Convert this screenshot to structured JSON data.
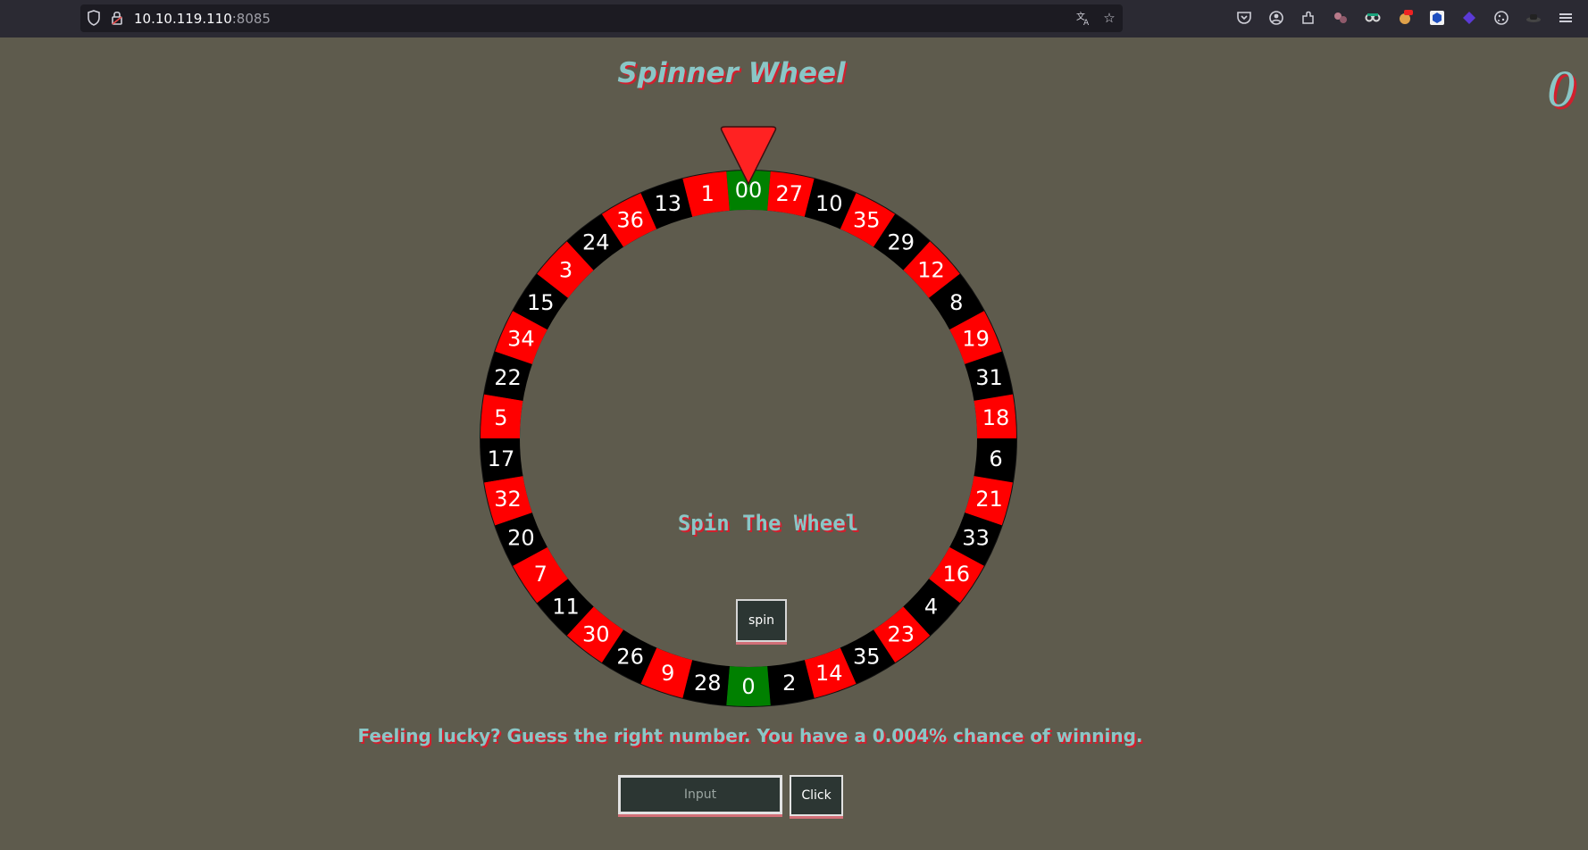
{
  "browser": {
    "url_host": "10.10.119.110",
    "url_port": ":8085",
    "icons": [
      "shield-icon",
      "lock-icon",
      "translate-icon",
      "star-icon",
      "pocket-icon",
      "account-icon",
      "extensions-icon",
      "extension-icon",
      "extension-icon",
      "extension-icon",
      "extension-icon",
      "extension-icon",
      "cookie-icon",
      "extension-icon",
      "menu-icon"
    ]
  },
  "page": {
    "title": "Spinner Wheel",
    "score": "0",
    "spin_caption": "Spin The Wheel",
    "spin_label": "spin",
    "lucky_text": "Feeling lucky? Guess the right number. You have a 0.004% chance of winning.",
    "input_placeholder": "Input",
    "click_label": "Click"
  },
  "colors": {
    "background": "#5e5b4d",
    "accent_teal": "#8ac6c6",
    "accent_red": "#d21f2d",
    "pocket_red": "#ff0000",
    "pocket_black": "#000000",
    "pocket_green": "#008000",
    "pointer": "#ff2222"
  },
  "wheel": {
    "pockets": [
      {
        "label": "00",
        "color": "green"
      },
      {
        "label": "27",
        "color": "red"
      },
      {
        "label": "10",
        "color": "black"
      },
      {
        "label": "35",
        "color": "red"
      },
      {
        "label": "29",
        "color": "black"
      },
      {
        "label": "12",
        "color": "red"
      },
      {
        "label": "8",
        "color": "black"
      },
      {
        "label": "19",
        "color": "red"
      },
      {
        "label": "31",
        "color": "black"
      },
      {
        "label": "18",
        "color": "red"
      },
      {
        "label": "6",
        "color": "black"
      },
      {
        "label": "21",
        "color": "red"
      },
      {
        "label": "33",
        "color": "black"
      },
      {
        "label": "16",
        "color": "red"
      },
      {
        "label": "4",
        "color": "black"
      },
      {
        "label": "23",
        "color": "red"
      },
      {
        "label": "35",
        "color": "black"
      },
      {
        "label": "14",
        "color": "red"
      },
      {
        "label": "2",
        "color": "black"
      },
      {
        "label": "0",
        "color": "green"
      },
      {
        "label": "28",
        "color": "black"
      },
      {
        "label": "9",
        "color": "red"
      },
      {
        "label": "26",
        "color": "black"
      },
      {
        "label": "30",
        "color": "red"
      },
      {
        "label": "11",
        "color": "black"
      },
      {
        "label": "7",
        "color": "red"
      },
      {
        "label": "20",
        "color": "black"
      },
      {
        "label": "32",
        "color": "red"
      },
      {
        "label": "17",
        "color": "black"
      },
      {
        "label": "5",
        "color": "red"
      },
      {
        "label": "22",
        "color": "black"
      },
      {
        "label": "34",
        "color": "red"
      },
      {
        "label": "15",
        "color": "black"
      },
      {
        "label": "3",
        "color": "red"
      },
      {
        "label": "24",
        "color": "black"
      },
      {
        "label": "36",
        "color": "red"
      },
      {
        "label": "13",
        "color": "black"
      },
      {
        "label": "1",
        "color": "red"
      }
    ]
  }
}
